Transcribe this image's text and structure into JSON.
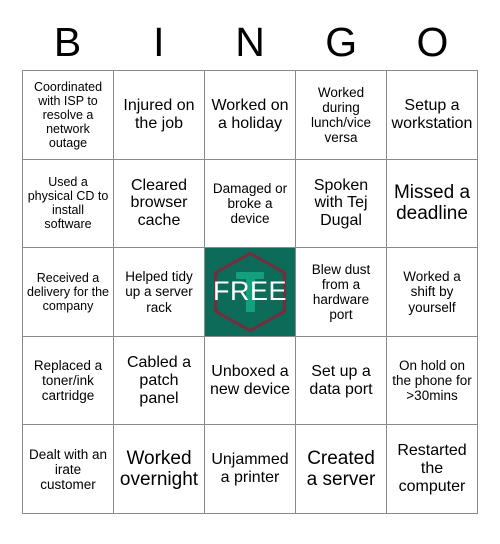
{
  "header": {
    "letters": [
      "B",
      "I",
      "N",
      "G",
      "O"
    ]
  },
  "colors": {
    "free_background": "#0d6b5a",
    "free_hexagon_stroke": "#6b3340",
    "free_logo_mark": "#13a07e",
    "free_text": "#ffffff",
    "grid_line": "#8a8a8a",
    "cell_background": "#ffffff",
    "cell_text": "#000000"
  },
  "grid": {
    "rows": 5,
    "columns": 5,
    "cells": [
      {
        "text": "Coordinated with ISP to resolve a network outage",
        "free": false
      },
      {
        "text": "Injured on the job",
        "free": false
      },
      {
        "text": "Worked on a holiday",
        "free": false
      },
      {
        "text": "Worked during lunch/vice versa",
        "free": false
      },
      {
        "text": "Setup a workstation",
        "free": false
      },
      {
        "text": "Used a physical CD to install software",
        "free": false
      },
      {
        "text": "Cleared browser cache",
        "free": false
      },
      {
        "text": "Damaged or broke a device",
        "free": false
      },
      {
        "text": "Spoken with Tej Dugal",
        "free": false
      },
      {
        "text": "Missed a deadline",
        "free": false
      },
      {
        "text": "Received a delivery for the company",
        "free": false
      },
      {
        "text": "Helped tidy up a server rack",
        "free": false
      },
      {
        "text": "FREE",
        "free": true
      },
      {
        "text": "Blew dust from a hardware port",
        "free": false
      },
      {
        "text": "Worked a shift by yourself",
        "free": false
      },
      {
        "text": "Replaced a toner/ink cartridge",
        "free": false
      },
      {
        "text": "Cabled a patch panel",
        "free": false
      },
      {
        "text": "Unboxed a new device",
        "free": false
      },
      {
        "text": "Set up a data port",
        "free": false
      },
      {
        "text": "On hold on the phone for >30mins",
        "free": false
      },
      {
        "text": "Dealt with an irate customer",
        "free": false
      },
      {
        "text": "Worked overnight",
        "free": false
      },
      {
        "text": "Unjammed a printer",
        "free": false
      },
      {
        "text": "Created a server",
        "free": false
      },
      {
        "text": "Restarted the computer",
        "free": false
      }
    ]
  }
}
